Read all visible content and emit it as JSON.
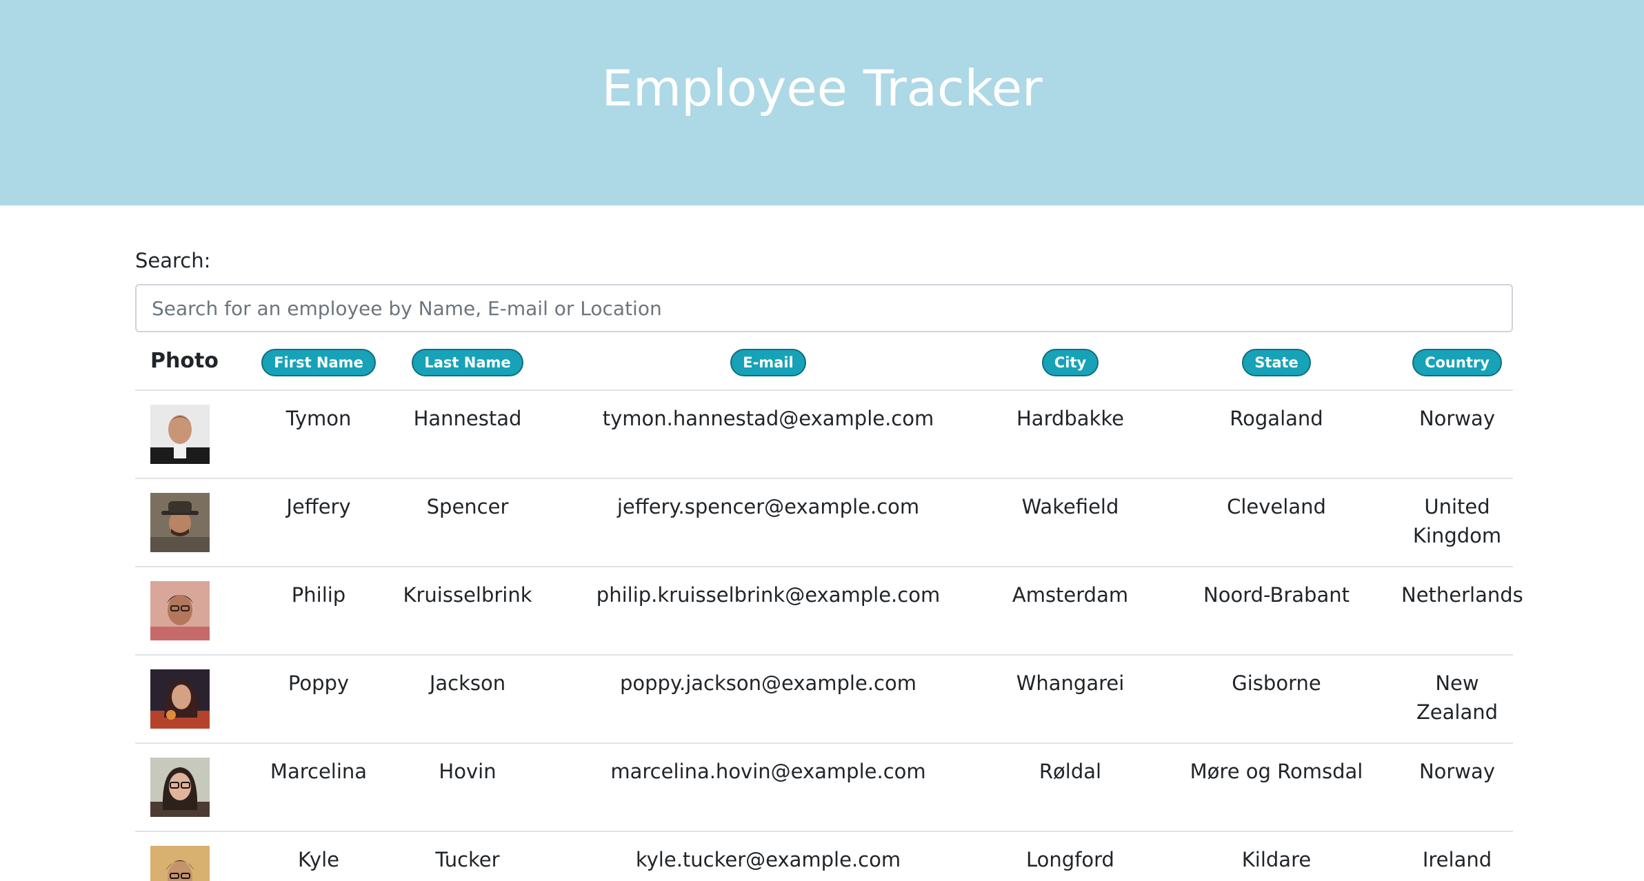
{
  "header": {
    "title": "Employee Tracker"
  },
  "search": {
    "label": "Search:",
    "placeholder": "Search for an employee by Name, E-mail or Location",
    "value": ""
  },
  "table": {
    "columns": {
      "photo": "Photo",
      "first_name": "First Name",
      "last_name": "Last Name",
      "email": "E-mail",
      "city": "City",
      "state": "State",
      "country": "Country"
    },
    "rows": [
      {
        "first": "Tymon",
        "last": "Hannestad",
        "email": "tymon.hannestad@example.com",
        "city": "Hardbakke",
        "state": "Rogaland",
        "country": "Norway"
      },
      {
        "first": "Jeffery",
        "last": "Spencer",
        "email": "jeffery.spencer@example.com",
        "city": "Wakefield",
        "state": "Cleveland",
        "country": "United Kingdom"
      },
      {
        "first": "Philip",
        "last": "Kruisselbrink",
        "email": "philip.kruisselbrink@example.com",
        "city": "Amsterdam",
        "state": "Noord-Brabant",
        "country": "Netherlands"
      },
      {
        "first": "Poppy",
        "last": "Jackson",
        "email": "poppy.jackson@example.com",
        "city": "Whangarei",
        "state": "Gisborne",
        "country": "New Zealand"
      },
      {
        "first": "Marcelina",
        "last": "Hovin",
        "email": "marcelina.hovin@example.com",
        "city": "Røldal",
        "state": "Møre og Romsdal",
        "country": "Norway"
      },
      {
        "first": "Kyle",
        "last": "Tucker",
        "email": "kyle.tucker@example.com",
        "city": "Longford",
        "state": "Kildare",
        "country": "Ireland"
      }
    ]
  },
  "colors": {
    "header_bg": "#add8e6",
    "sort_button": "#17a2b8"
  }
}
